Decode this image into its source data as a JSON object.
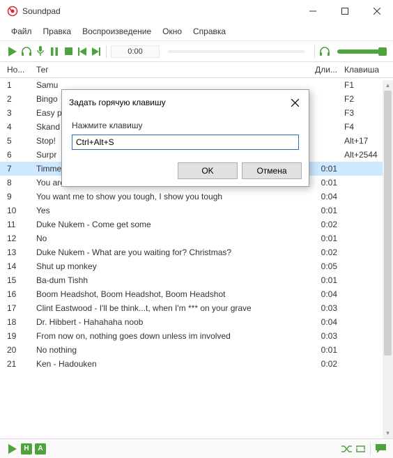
{
  "window": {
    "title": "Soundpad"
  },
  "menu": {
    "file": "Файл",
    "edit": "Правка",
    "playback": "Воспроизведение",
    "window": "Окно",
    "help": "Справка"
  },
  "toolbar": {
    "time": "0:00"
  },
  "columns": {
    "no": "Но...",
    "tag": "Тег",
    "dur": "Дли...",
    "key": "Клавиша"
  },
  "rows": [
    {
      "no": "1",
      "tag": "Samu",
      "dur": "",
      "key": "F1"
    },
    {
      "no": "2",
      "tag": "Bingo",
      "dur": "",
      "key": "F2"
    },
    {
      "no": "3",
      "tag": "Easy p",
      "dur": "",
      "key": "F3"
    },
    {
      "no": "4",
      "tag": "Skand",
      "dur": "",
      "key": "F4"
    },
    {
      "no": "5",
      "tag": "Stop!",
      "dur": "",
      "key": "Alt+17"
    },
    {
      "no": "6",
      "tag": "Surpr",
      "dur": "",
      "key": "Alt+2544"
    },
    {
      "no": "7",
      "tag": "Timmey",
      "dur": "0:01",
      "key": "",
      "selected": true
    },
    {
      "no": "8",
      "tag": "You are an idiot",
      "dur": "0:01",
      "key": ""
    },
    {
      "no": "9",
      "tag": "You want me to show you tough, I show you tough",
      "dur": "0:04",
      "key": ""
    },
    {
      "no": "10",
      "tag": "Yes",
      "dur": "0:01",
      "key": ""
    },
    {
      "no": "11",
      "tag": "Duke Nukem - Come get some",
      "dur": "0:02",
      "key": ""
    },
    {
      "no": "12",
      "tag": "No",
      "dur": "0:01",
      "key": ""
    },
    {
      "no": "13",
      "tag": "Duke Nukem - What are you waiting for? Christmas?",
      "dur": "0:02",
      "key": ""
    },
    {
      "no": "14",
      "tag": "Shut up monkey",
      "dur": "0:05",
      "key": ""
    },
    {
      "no": "15",
      "tag": "Ba-dum Tishh",
      "dur": "0:01",
      "key": ""
    },
    {
      "no": "16",
      "tag": "Boom Headshot, Boom Headshot, Boom Headshot",
      "dur": "0:04",
      "key": ""
    },
    {
      "no": "17",
      "tag": "Clint Eastwood - I'll be think...t, when I'm *** on your grave",
      "dur": "0:03",
      "key": ""
    },
    {
      "no": "18",
      "tag": "Dr. Hibbert - Hahahaha noob",
      "dur": "0:04",
      "key": ""
    },
    {
      "no": "19",
      "tag": "From now on, nothing goes down unless im involved",
      "dur": "0:03",
      "key": ""
    },
    {
      "no": "20",
      "tag": "No nothing",
      "dur": "0:01",
      "key": ""
    },
    {
      "no": "21",
      "tag": "Ken - Hadouken",
      "dur": "0:02",
      "key": ""
    }
  ],
  "dialog": {
    "title": "Задать горячую клавишу",
    "label": "Нажмите клавишу",
    "input": "Ctrl+Alt+S",
    "ok": "OK",
    "cancel": "Отмена"
  },
  "bottombar": {
    "h": "Н",
    "a": "А"
  }
}
